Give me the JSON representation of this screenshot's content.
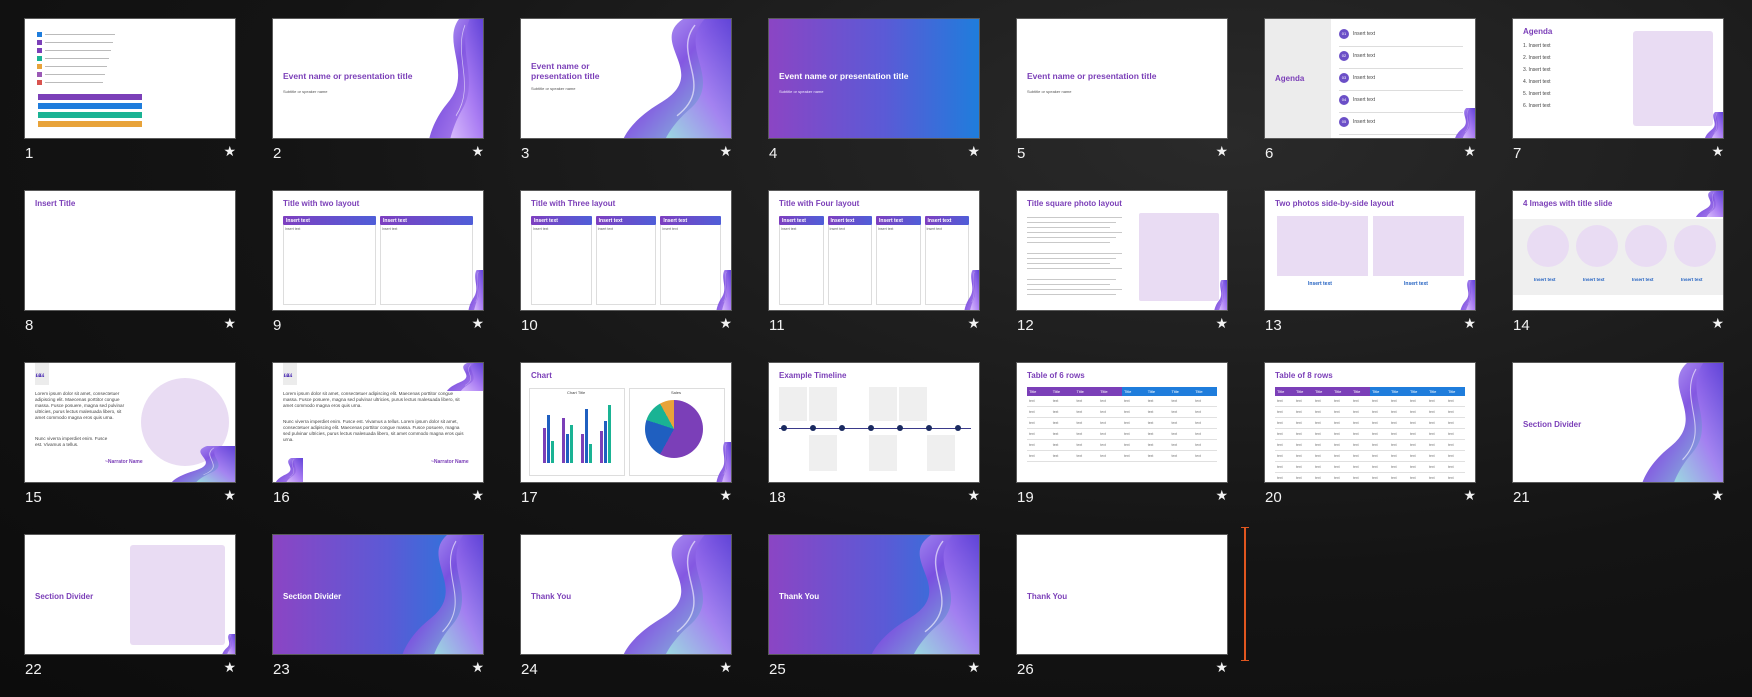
{
  "slides": [
    {
      "number": "1",
      "type": "bars"
    },
    {
      "number": "2",
      "type": "title_ribbon_right",
      "title": "Event name or presentation title",
      "subtitle": "Subtitle or speaker name"
    },
    {
      "number": "3",
      "type": "title_ribbon_right_big",
      "title": "Event name or presentation title",
      "subtitle": "Subtitle or speaker name"
    },
    {
      "number": "4",
      "type": "title_gradient",
      "title": "Event name or presentation title",
      "subtitle": "Subtitle or speaker name"
    },
    {
      "number": "5",
      "type": "title_plain",
      "title": "Event name or presentation title",
      "subtitle": "Subtitle or speaker name"
    },
    {
      "number": "6",
      "type": "agenda_numbered",
      "title": "Agenda",
      "items": [
        "01",
        "02",
        "03",
        "04",
        "05"
      ],
      "item_text": "Insert text"
    },
    {
      "number": "7",
      "type": "agenda_list",
      "title": "Agenda",
      "items": [
        "1. Insert text",
        "2. Insert text",
        "3. Insert text",
        "4. Insert text",
        "5. Insert text",
        "6. Insert text"
      ]
    },
    {
      "number": "8",
      "type": "insert_title",
      "title": "Insert Title"
    },
    {
      "number": "9",
      "type": "columns",
      "title": "Title with two layout",
      "columns": 2,
      "header": "Insert text",
      "body": "Insert text"
    },
    {
      "number": "10",
      "type": "columns",
      "title": "Title with Three layout",
      "columns": 3,
      "header": "Insert text",
      "body": "Insert text"
    },
    {
      "number": "11",
      "type": "columns",
      "title": "Title with Four layout",
      "columns": 4,
      "header": "Insert text",
      "body": "Insert text"
    },
    {
      "number": "12",
      "type": "square_photo",
      "title": "Title square photo layout"
    },
    {
      "number": "13",
      "type": "two_photos",
      "title": "Two photos side-by-side layout",
      "caption": "Insert text"
    },
    {
      "number": "14",
      "type": "four_images",
      "title": "4 Images with title slide",
      "caption": "Insert text"
    },
    {
      "number": "15",
      "type": "quote_circle",
      "quote": "Lorem ipsum dolor sit amet, consectetuer adipiscing elit. Maecenas porttitor congue massa. Fusce posuere, magna sed pulvinar ultricies, purus lectus malesuada libero, sit amet commodo magna eros quis urna.",
      "quote2": "Nunc viverra imperdiet enim. Fusce est. Vivamus a tellus.",
      "author": "~Narrator Name"
    },
    {
      "number": "16",
      "type": "quote_wide",
      "quote": "Lorem ipsum dolor sit amet, consectetuer adipiscing elit. Maecenas porttitor congue massa. Fusce posuere, magna sed pulvinar ultricies, purus lectus malesuada libero, sit amet commodo magna eros quis urna.",
      "quote2": "Nunc viverra imperdiet enim. Fusce est. Vivamus a tellus. Lorem ipsum dolor sit amet, consectetuer adipiscing elit. Maecenas porttitor congue massa. Fusce posuere, magna sed pulvinar ultricies, purus lectus malesuada libero, sit amet commodo magna eros quis urna.",
      "author": "~Narrator Name"
    },
    {
      "number": "17",
      "type": "chart",
      "title": "Chart",
      "chart1_title": "Chart Title",
      "chart2_title": "Sales"
    },
    {
      "number": "18",
      "type": "timeline",
      "title": "Example Timeline"
    },
    {
      "number": "19",
      "type": "table",
      "title": "Table of 6 rows",
      "cols": 8,
      "rows": 6,
      "head": "Title",
      "cell": "text"
    },
    {
      "number": "20",
      "type": "table",
      "title": "Table of 8 rows",
      "cols": 10,
      "rows": 8,
      "head": "Title",
      "cell": "text"
    },
    {
      "number": "21",
      "type": "section_ribbon",
      "title": "Section Divider"
    },
    {
      "number": "22",
      "type": "section_box",
      "title": "Section Divider"
    },
    {
      "number": "23",
      "type": "section_gradient",
      "title": "Section Divider"
    },
    {
      "number": "24",
      "type": "thanks_ribbon",
      "title": "Thank You"
    },
    {
      "number": "25",
      "type": "thanks_gradient",
      "title": "Thank You"
    },
    {
      "number": "26",
      "type": "thanks_plain",
      "title": "Thank You"
    }
  ],
  "star_glyph": "★",
  "colors": {
    "accent": "#7b3fb8",
    "blue": "#1f7ddc",
    "lavender": "#e9dcf3",
    "insert_marker": "#e0561f"
  }
}
